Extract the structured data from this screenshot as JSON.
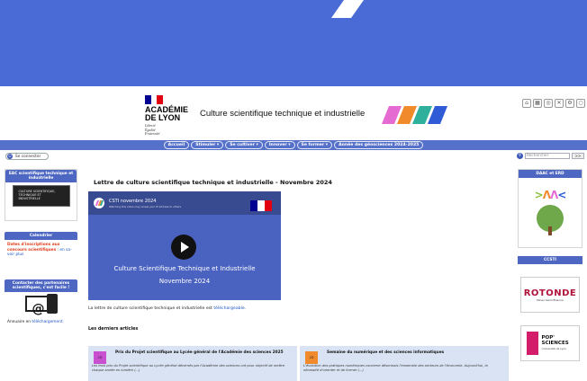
{
  "header": {
    "academie_line1": "ACADÉMIE",
    "academie_line2": "DE LYON",
    "motto": [
      "Liberté",
      "Égalité",
      "Fraternité"
    ],
    "site_title": "Culture scientifique technique et industrielle",
    "flag_colors": [
      "#000091",
      "#ffffff",
      "#e1000f"
    ],
    "stripe_colors": [
      "#e56bd2",
      "#f08a2b",
      "#2fb09c",
      "#2f5bd6"
    ],
    "tool_icons": [
      "home-icon",
      "grid-icon",
      "accessibility-icon",
      "share-icon",
      "settings-icon",
      "user-icon"
    ]
  },
  "nav": {
    "items": [
      {
        "label": "Accueil"
      },
      {
        "label": "Stimuler ▾"
      },
      {
        "label": "Se cultiver ▾"
      },
      {
        "label": "Innover ▾"
      },
      {
        "label": "Se former ▾"
      },
      {
        "label": "Année des géosciences 2024-2025"
      }
    ]
  },
  "account": {
    "connect_label": "Se connecter"
  },
  "search": {
    "placeholder": "Rechercher",
    "button": ">>"
  },
  "left_sidebar": {
    "eac": {
      "title": "EAC scientifique technique et industrielle",
      "image_text": "CULTURE SCIENTIFIQUE, TECHNIQUE ET INDUSTRIELLE"
    },
    "calendar": {
      "title": "Calendrier",
      "red_text": "Dates d'inscriptions aux concours scientifiques",
      "sep": " : ",
      "link": "en sa-voir plus"
    },
    "contact": {
      "title": "Contacter des partenaires scientifiques, c'est facile !",
      "text": "Annuaire en ",
      "link": "téléchargement."
    }
  },
  "main": {
    "title": "Lettre de culture scientifique technique et industrielle - Novembre 2024",
    "video": {
      "channel_title": "CSTI novembre 2024",
      "channel_sub": "Watching this video may reveal your IP address to others",
      "caption_line1": "Culture Scientifique Technique et Industrielle",
      "caption_line2": "Novembre 2024"
    },
    "intro_text": "La lettre de culture scientifique technique et industrielle est ",
    "intro_link": "téléchargeable.",
    "articles_heading": "Les derniers articles",
    "articles": [
      {
        "thumb": "2D",
        "thumb_color": "#c94fd1",
        "title": "Prix du Projet scientifique au Lycée général de l'Académie des sciences 2025",
        "desc": "Les trois prix du Projet scientifique au Lycée général décernés par l'Académie des sciences ont pour objectif de mettre chaque année en lumière (...)"
      },
      {
        "thumb": "2D",
        "thumb_color": "#f08a2b",
        "title": "Semaine du numérique et des sciences informatiques",
        "desc": "L'évolution des pratiques numériques concerne désormais l'ensemble des secteurs de l'économie. Aujourd'hui, la nécessité d'orienter et de former (...)"
      }
    ]
  },
  "right_sidebar": {
    "daac": {
      "title": "DAAC et ERD",
      "logo": ">ΛΛ<"
    },
    "csti": {
      "title": "CCSTI",
      "rotonde": "ROTONDE",
      "rotonde_sub": "Mines Saint-Étienne",
      "pop_title": "POP' SCIENCES",
      "pop_sub": "Université de Lyon"
    }
  }
}
